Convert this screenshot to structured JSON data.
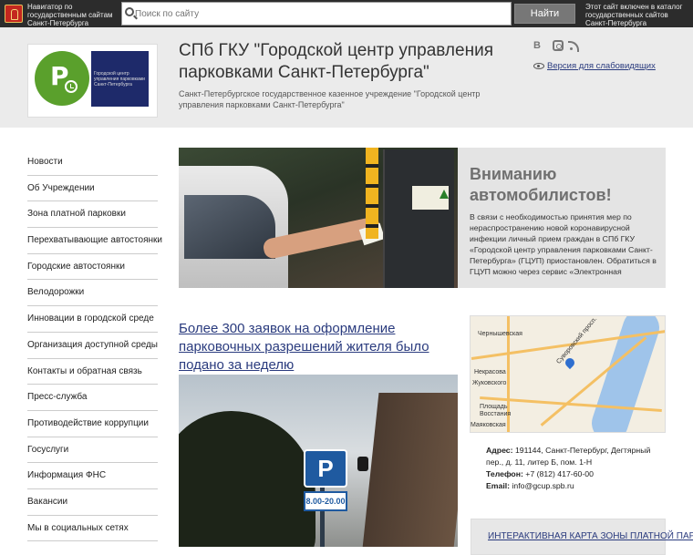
{
  "topbar": {
    "navigator_text": "Навигатор по государственным сайтам Санкт-Петербурга",
    "search_placeholder": "Поиск по сайту",
    "search_button": "Найти",
    "catalog_text": "Этот сайт включен в каталог государственных сайтов Санкт-Петербурга"
  },
  "header": {
    "logo_caption": "Городской центр управления парковками Санкт-Петербурга",
    "logo_letter": "P",
    "title": "СПб ГКУ \"Городской центр управления парковками Санкт-Петербурга\"",
    "subtitle": "Санкт-Петербургское государственное казенное учреждение \"Городской центр управления парковками Санкт-Петербурга\"",
    "vk_icon": "В",
    "vision_link": "Версия для слабовидящих"
  },
  "sidebar": {
    "items": [
      {
        "label": "Новости"
      },
      {
        "label": "Об Учреждении"
      },
      {
        "label": "Зона платной парковки"
      },
      {
        "label": "Перехватывающие автостоянки"
      },
      {
        "label": "Городские автостоянки"
      },
      {
        "label": "Велодорожки"
      },
      {
        "label": "Инновации в городской среде"
      },
      {
        "label": "Организация доступной среды"
      },
      {
        "label": "Контакты и обратная связь"
      },
      {
        "label": "Пресс-служба"
      },
      {
        "label": "Противодействие коррупции"
      },
      {
        "label": "Госуслуги"
      },
      {
        "label": "Информация ФНС"
      },
      {
        "label": "Вакансии"
      },
      {
        "label": "Мы в социальных сетях"
      }
    ]
  },
  "attention": {
    "title": "Вниманию автомобилистов!",
    "text": "В связи с необходимостью принятия мер по нераспространению новой коронавирусной инфекции личный прием граждан в СПб ГКУ «Городской центр управления парковками Санкт-Петербурга» (ГЦУП) приостановлен. Обратиться в ГЦУП можно через сервис «Электронная"
  },
  "news": {
    "title": "Более 300 заявок на оформление парковочных разрешений жителя было подано за неделю",
    "sign_letter": "P",
    "sign_time": "8.00-20.00"
  },
  "map": {
    "labels": [
      "Чернышевская",
      "Некрасова",
      "Жуковского",
      "Площадь Восстания",
      "Маяковская",
      "Суворовский просп."
    ]
  },
  "contacts": {
    "address_label": "Адрес:",
    "address": "191144, Санкт-Петербург, Дегтярный пер., д. 11, литер Б, пом. 1-Н",
    "phone_label": "Телефон:",
    "phone": "+7 (812) 417-60-00",
    "email_label": "Email:",
    "email": "info@gcup.spb.ru"
  },
  "interactive": {
    "link": "ИНТЕРАКТИВНАЯ КАРТА ЗОНЫ ПЛАТНОЙ ПАРКОВКИ"
  }
}
